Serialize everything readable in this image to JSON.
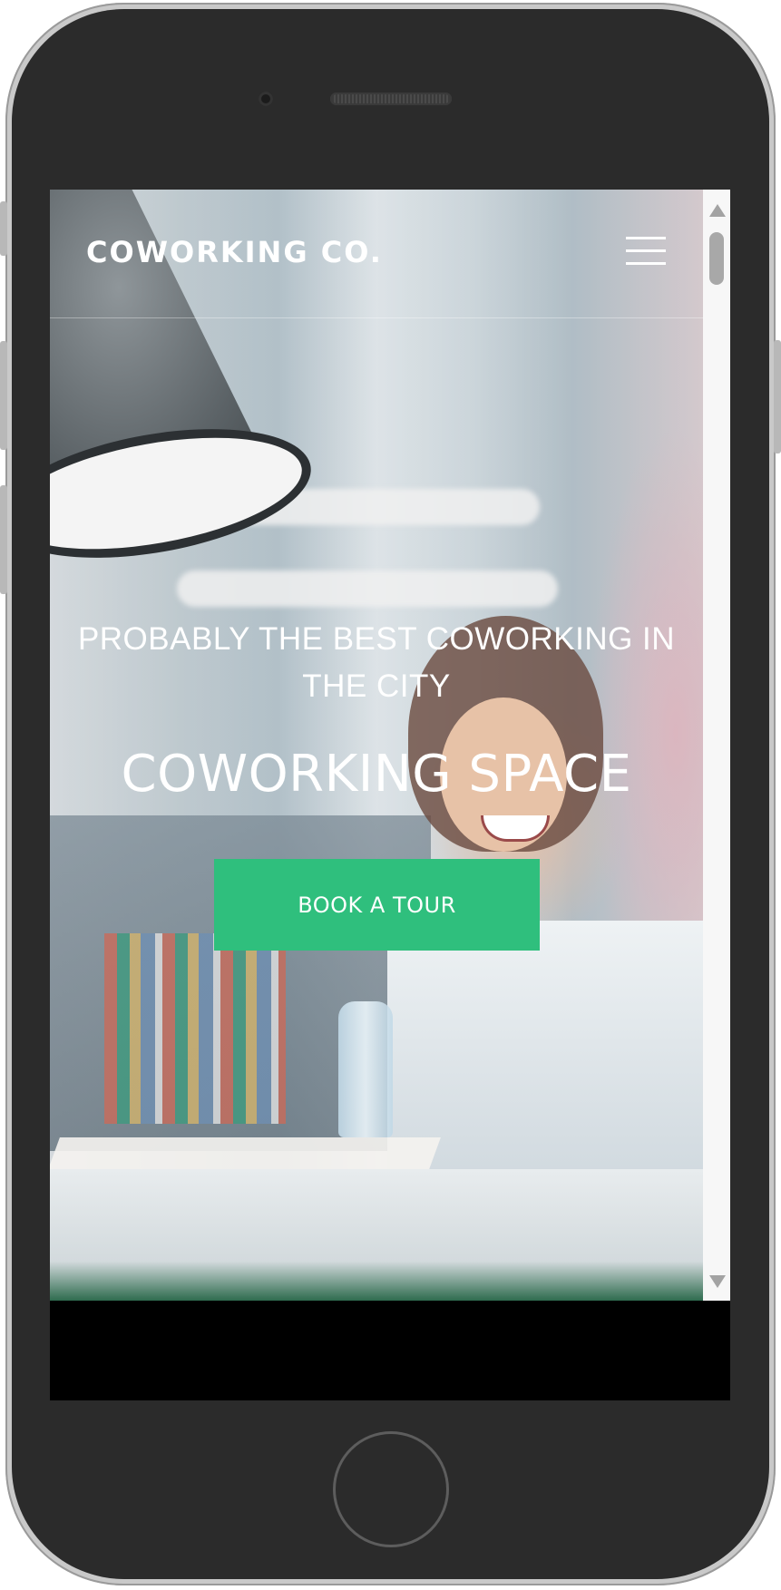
{
  "brand": {
    "logo_text": "COWORKING CO."
  },
  "nav": {
    "menu_icon": "hamburger-menu-icon"
  },
  "hero": {
    "tagline": "PROBABLY THE BEST COWORKING IN THE CITY",
    "title": "COWORKING SPACE",
    "cta_label": "BOOK A TOUR",
    "background": "coworking office photo of smiling woman at laptop"
  },
  "colors": {
    "accent": "#2fbf7d",
    "hero_text": "#ffffff",
    "device_frame": "#2b2b2b"
  },
  "scrollbar": {
    "up_icon": "scroll-up-arrow-icon",
    "down_icon": "scroll-down-arrow-icon"
  },
  "device": {
    "camera_icon": "camera-icon",
    "speaker_icon": "speaker-grille-icon",
    "home_icon": "home-button-icon"
  }
}
